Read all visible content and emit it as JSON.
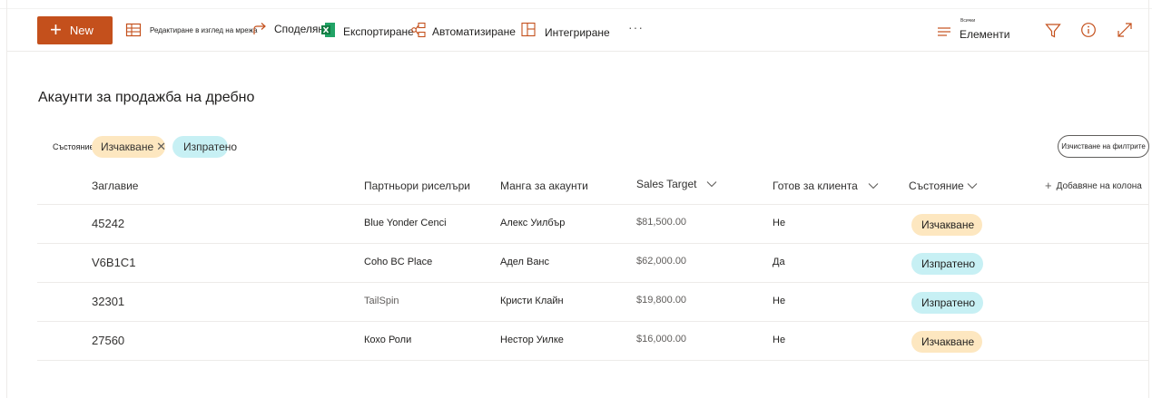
{
  "colors": {
    "accent": "#c4501c",
    "pending_bg": "#fde7c0",
    "sent_bg": "#c7f0f4",
    "icon": "#c4501c"
  },
  "toolbar": {
    "new_label": "New",
    "edit_grid_label": "Редактиране в изглед на мрежа",
    "share_label": "Споделяне",
    "export_label": "Експортиране",
    "automate_label": "Автоматизиране",
    "integrate_label": "Интегриране",
    "more_label": "···",
    "view_small_label": "Всички",
    "view_label": "Елементи"
  },
  "page": {
    "title": "Акаунти за продажба на дребно"
  },
  "filters": {
    "label": "Състояние:",
    "pills": [
      {
        "label": "Изчакване",
        "active": true
      },
      {
        "label": "Изпратено",
        "active": false
      }
    ],
    "clear_label": "Изчистване на филтрите"
  },
  "table": {
    "columns": [
      "Заглавие",
      "Партньори риселъри",
      "Мангa за акаунти",
      "Sales Target",
      "Готов за клиента",
      "Състояние"
    ],
    "add_column_label": "Добавяне на колона",
    "rows": [
      {
        "title": "45242",
        "partner": "Blue Yonder Cenci",
        "manager": "Алекс Уилбър",
        "target": "$81,500.00",
        "ready": "Не",
        "status": "Изчакване",
        "status_kind": "pending"
      },
      {
        "title": "V6B1C1",
        "partner": "Coho BC Place",
        "manager": "Адел Ванс",
        "target": "$62,000.00",
        "ready": "Да",
        "status": "Изпратено",
        "status_kind": "sent"
      },
      {
        "title": "32301",
        "partner": "TailSpin",
        "manager": "Кристи Клайн",
        "target": "$19,800.00",
        "ready": "Не",
        "status": "Изпратено",
        "status_kind": "sent"
      },
      {
        "title": "27560",
        "partner": "Кохо Роли",
        "manager": "Нестор Уилке",
        "target": "$16,000.00",
        "ready": "Не",
        "status": "Изчакване",
        "status_kind": "pending"
      }
    ]
  }
}
